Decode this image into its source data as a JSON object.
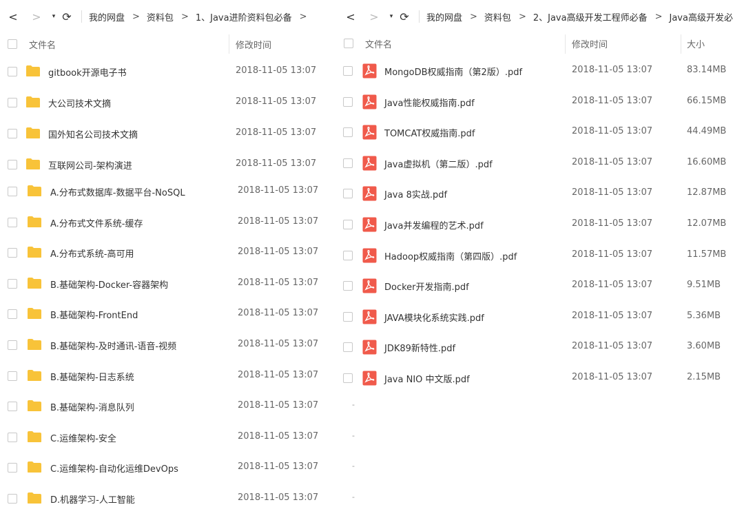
{
  "left": {
    "nav": {
      "back": "<",
      "forward": ">",
      "dropdown": "▾",
      "refresh": "⟳",
      "breadcrumbs": [
        "我的网盘",
        "资料包",
        "1、Java进阶资料包必备"
      ],
      "trailing_arrow": ">"
    },
    "columns": {
      "name": "文件名",
      "modified": "修改时间"
    },
    "rows": [
      {
        "name": "gitbook开源电子书",
        "modified": "2018-11-05 13:07"
      },
      {
        "name": "大公司技术文摘",
        "modified": "2018-11-05 13:07"
      },
      {
        "name": "国外知名公司技术文摘",
        "modified": "2018-11-05 13:07"
      },
      {
        "name": "互联网公司-架构演进",
        "modified": "2018-11-05 13:07"
      },
      {
        "name": "A.分布式数据库-数据平台-NoSQL",
        "modified": "2018-11-05 13:07"
      },
      {
        "name": "A.分布式文件系统-缓存",
        "modified": "2018-11-05 13:07"
      },
      {
        "name": "A.分布式系统-高可用",
        "modified": "2018-11-05 13:07"
      },
      {
        "name": "B.基础架构-Docker-容器架构",
        "modified": "2018-11-05 13:07"
      },
      {
        "name": "B.基础架构-FrontEnd",
        "modified": "2018-11-05 13:07"
      },
      {
        "name": "B.基础架构-及时通讯-语音-视频",
        "modified": "2018-11-05 13:07"
      },
      {
        "name": "B.基础架构-日志系统",
        "modified": "2018-11-05 13:07"
      },
      {
        "name": "B.基础架构-消息队列",
        "modified": "2018-11-05 13:07"
      },
      {
        "name": "C.运维架构-安全",
        "modified": "2018-11-05 13:07"
      },
      {
        "name": "C.运维架构-自动化运维DevOps",
        "modified": "2018-11-05 13:07"
      },
      {
        "name": "D.机器学习-人工智能",
        "modified": "2018-11-05 13:07"
      }
    ],
    "size_placeholder": "-"
  },
  "right": {
    "nav": {
      "back": "<",
      "forward": ">",
      "dropdown": "▾",
      "refresh": "⟳",
      "breadcrumbs": [
        "我的网盘",
        "资料包",
        "2、Java高级开发工程师必备",
        "Java高级开发必"
      ]
    },
    "columns": {
      "name": "文件名",
      "modified": "修改时间",
      "size": "大小"
    },
    "rows": [
      {
        "name": "MongoDB权威指南（第2版）.pdf",
        "modified": "2018-11-05 13:07",
        "size": "83.14MB"
      },
      {
        "name": "Java性能权威指南.pdf",
        "modified": "2018-11-05 13:07",
        "size": "66.15MB"
      },
      {
        "name": "TOMCAT权威指南.pdf",
        "modified": "2018-11-05 13:07",
        "size": "44.49MB"
      },
      {
        "name": "Java虚拟机（第二版）.pdf",
        "modified": "2018-11-05 13:07",
        "size": "16.60MB"
      },
      {
        "name": "Java 8实战.pdf",
        "modified": "2018-11-05 13:07",
        "size": "12.87MB"
      },
      {
        "name": "Java并发编程的艺术.pdf",
        "modified": "2018-11-05 13:07",
        "size": "12.07MB"
      },
      {
        "name": "Hadoop权威指南（第四版）.pdf",
        "modified": "2018-11-05 13:07",
        "size": "11.57MB"
      },
      {
        "name": "Docker开发指南.pdf",
        "modified": "2018-11-05 13:07",
        "size": "9.51MB"
      },
      {
        "name": "JAVA模块化系统实践.pdf",
        "modified": "2018-11-05 13:07",
        "size": "5.36MB"
      },
      {
        "name": "JDK89新特性.pdf",
        "modified": "2018-11-05 13:07",
        "size": "3.60MB"
      },
      {
        "name": "Java NIO 中文版.pdf",
        "modified": "2018-11-05 13:07",
        "size": "2.15MB"
      }
    ]
  },
  "icons": {
    "folder_icon": "folder-icon",
    "pdf_icon": "pdf-icon",
    "checkbox": "checkbox"
  },
  "colors": {
    "folder": "#f8c33a",
    "pdf": "#f05a4b",
    "text": "#333333",
    "muted": "#666666"
  }
}
